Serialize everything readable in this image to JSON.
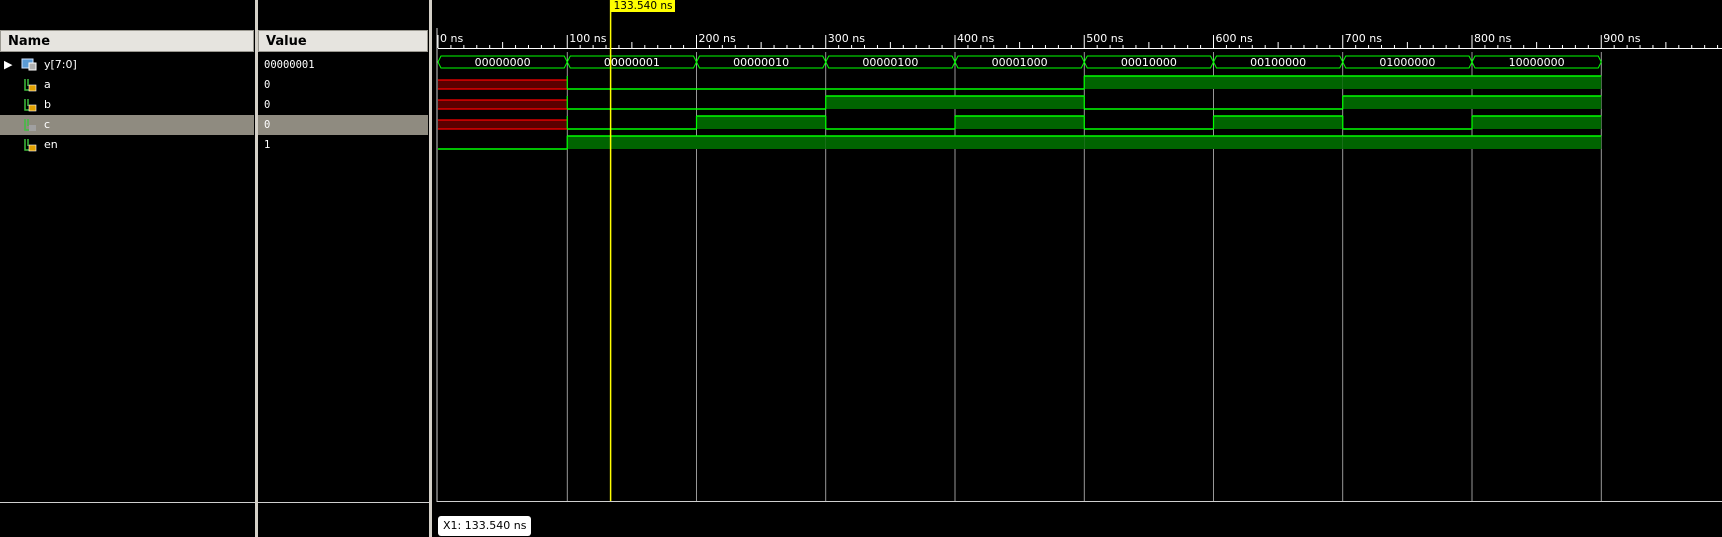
{
  "name_panel": {
    "header": "Name",
    "signals": [
      {
        "name": "y[7:0]",
        "icon": "bus-icon",
        "expandable": true
      },
      {
        "name": "a",
        "icon": "wire-lock-icon"
      },
      {
        "name": "b",
        "icon": "wire-lock-icon"
      },
      {
        "name": "c",
        "icon": "wire-icon",
        "selected": true
      },
      {
        "name": "en",
        "icon": "wire-lock-icon"
      }
    ]
  },
  "value_panel": {
    "header": "Value",
    "values": [
      "00000001",
      "0",
      "0",
      "0",
      "1"
    ]
  },
  "timeline": {
    "ticks": [
      "0 ns",
      "100 ns",
      "200 ns",
      "300 ns",
      "400 ns",
      "500 ns",
      "600 ns",
      "700 ns",
      "800 ns",
      "900 ns"
    ],
    "bus_values": [
      "00000000",
      "00000001",
      "00000010",
      "00000100",
      "00001000",
      "00010000",
      "00100000",
      "01000000",
      "10000000"
    ],
    "a_levels": [
      "x",
      0,
      0,
      0,
      0,
      1,
      1,
      1,
      1
    ],
    "b_levels": [
      "x",
      0,
      0,
      1,
      1,
      0,
      0,
      1,
      1
    ],
    "c_levels": [
      "x",
      0,
      1,
      0,
      1,
      0,
      1,
      0,
      1
    ],
    "en_levels": [
      0,
      1,
      1,
      1,
      1,
      1,
      1,
      1,
      1
    ],
    "cursor_time_ns": 133.54,
    "cursor_label": "133.540 ns",
    "x1_label": "X1: 133.540 ns"
  },
  "colors": {
    "wave": "#00ff00",
    "wave_fill": "#006400",
    "unknown": "#ff0000",
    "cursor": "#ffff00",
    "grid": "#ffffff"
  }
}
